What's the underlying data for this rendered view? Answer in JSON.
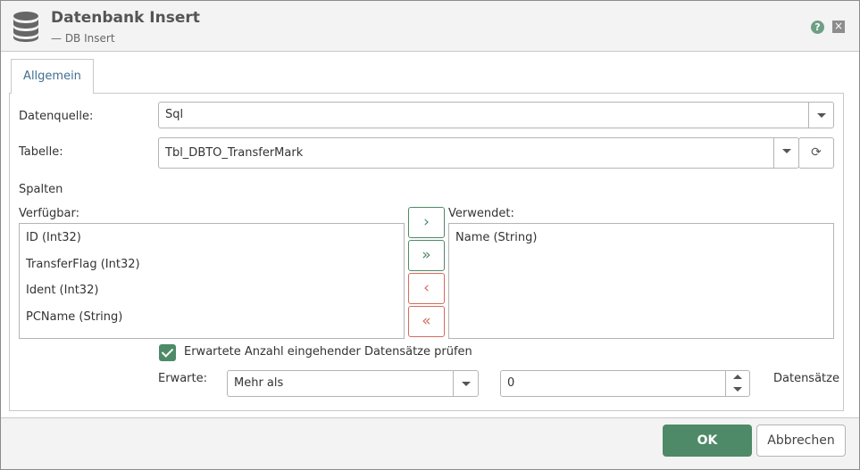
{
  "window": {
    "title": "Datenbank Insert",
    "subtitle": "— DB Insert",
    "help_symbol": "?",
    "close_symbol": "×"
  },
  "tabs": [
    {
      "label": "Allgemein",
      "active": true
    }
  ],
  "form": {
    "datasource_label": "Datenquelle:",
    "datasource_value": "Sql",
    "table_label": "Tabelle:",
    "table_value": "Tbl_DBTO_TransferMark",
    "refresh_symbol": "⟳",
    "columns_label": "Spalten",
    "available_label": "Verfügbar:",
    "used_label": "Verwendet:",
    "available_items": [
      "ID (Int32)",
      "TransferFlag (Int32)",
      "Ident (Int32)",
      "PCName (String)"
    ],
    "used_items": [
      "Name (String)"
    ],
    "move_buttons": {
      "add_one": "›",
      "add_all": "»",
      "remove_one": "‹",
      "remove_all": "«"
    },
    "check_label": "Erwartete Anzahl eingehender Datensätze prüfen",
    "check_checked": true,
    "expect_label": "Erwarte:",
    "expect_value": "Mehr als",
    "count_value": "0",
    "records_label": "Datensätze"
  },
  "footer": {
    "ok_label": "OK",
    "cancel_label": "Abbrechen"
  },
  "colors": {
    "accent_green": "#4e8a67",
    "remove_red": "#d46a5a",
    "tab_text": "#3f6f8f"
  },
  "icons": [
    "database-icon",
    "help-icon",
    "close-icon",
    "refresh-icon",
    "chevron-down-icon"
  ]
}
